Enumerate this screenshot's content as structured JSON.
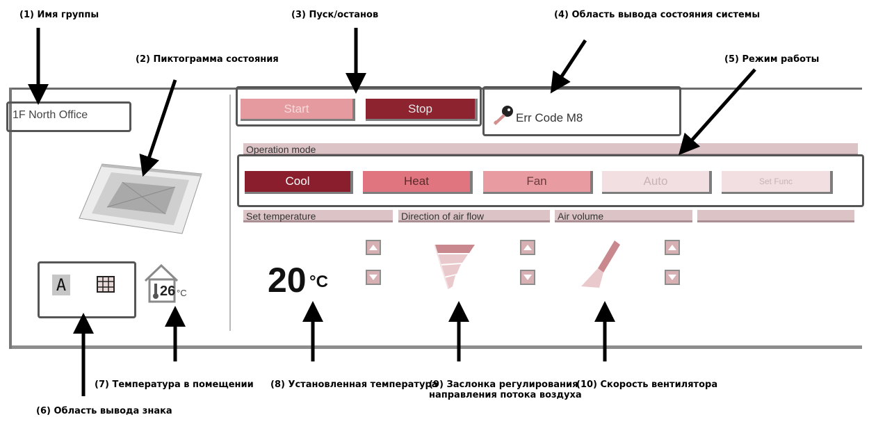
{
  "annotations": {
    "group_name": "(1) Имя группы",
    "status_icon": "(2) Пиктограмма состояния",
    "start_stop": "(3) Пуск/останов",
    "system_status": "(4) Область вывода состояния системы",
    "operation_mode": "(5) Режим работы",
    "sign_area": "(6) Область вывода знака",
    "room_temp": "(7) Температура в помещении",
    "set_temp": "(8) Установленная температура",
    "airflow_line1": "(9) Заслонка регулирования",
    "airflow_line2": "направления потока воздуха",
    "fan_speed": "(10) Скорость вентилятора"
  },
  "panel": {
    "group_name": "1F North Office",
    "start_label": "Start",
    "stop_label": "Stop",
    "status_text": "Err Code M8",
    "operation_mode_title": "Operation mode",
    "modes": [
      "Cool",
      "Heat",
      "Fan",
      "Auto",
      "Set Func"
    ],
    "set_temperature_title": "Set temperature",
    "direction_title": "Direction of air flow",
    "air_volume_title": "Air volume",
    "set_temperature_value": "20",
    "set_temperature_unit": "°C",
    "room_temperature_value": "26",
    "room_temperature_unit": "°C",
    "sign_letter": "A"
  },
  "colors": {
    "stop_active": "#8e2330",
    "start_inactive": "#e59a9f",
    "cool_active": "#8b1e2c",
    "bar": "#dcc3c6"
  }
}
